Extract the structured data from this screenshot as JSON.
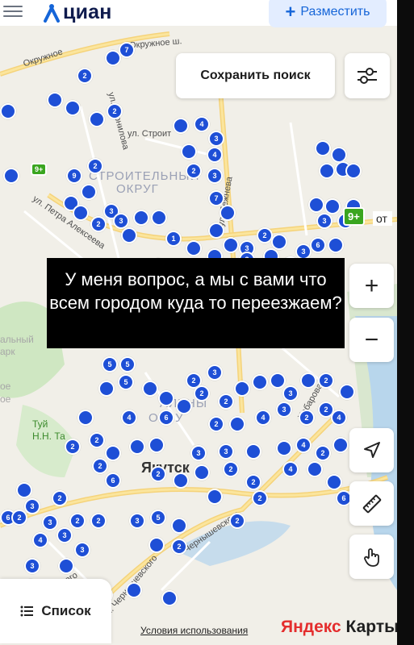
{
  "header": {
    "brand": "циан",
    "post_button": "Разместить"
  },
  "map": {
    "controls": {
      "save_search": "Сохранить поиск",
      "zoom_in": "+",
      "zoom_out": "−"
    },
    "labels": {
      "street_okruzhnoe": "Окружное",
      "street_okruzhnoe_sh": "Окружное ш.",
      "street_stroit": "ул. Строит",
      "street_kornilova": "ул. Корнилова",
      "street_petra_alekseeva": "ул. Петра Алексеева",
      "street_khabarova": "Хабарова",
      "street_chernyshevskogo": "ул. Чернышевского",
      "street_chernyshevskogo_2": "Чернышевского",
      "street_dezhneva": "ул. Дежнева",
      "park_1": "альный",
      "park_2": "арк",
      "district_stroitelny_1": "СТРОИТЕЛЬНЫЙ",
      "district_stroitelny_2": "ОКРУГ",
      "district_gubinsky_1": "АЛЬНЫ",
      "district_gubinsky_2": "ОКРУ",
      "city": "Якутск",
      "poi_tui_1": "Туй",
      "poi_tui_2": "Н.Н. Та",
      "street_ulakhovskogo": "улаховского",
      "street_chernyshevskogo_low": "ул. Чернышевского",
      "street_left_edge": "ое",
      "street_left_edge_2": "ое"
    },
    "badge_9plus_top": "9+",
    "badge_9plus_right": "9+",
    "badge_ot": "от",
    "caption": "У меня вопрос, а мы с вами что всем городом куда то переезжаем?"
  },
  "footer": {
    "list_button": "Список",
    "terms_link": "Условия использования",
    "yandex_ya": "Яндекс",
    "yandex_karty": "Карты"
  },
  "colors": {
    "cluster": "#1e4fd6",
    "brand_blue": "#1565d8",
    "green_badge": "#3aa51f",
    "map_bg": "#f1efe8"
  }
}
